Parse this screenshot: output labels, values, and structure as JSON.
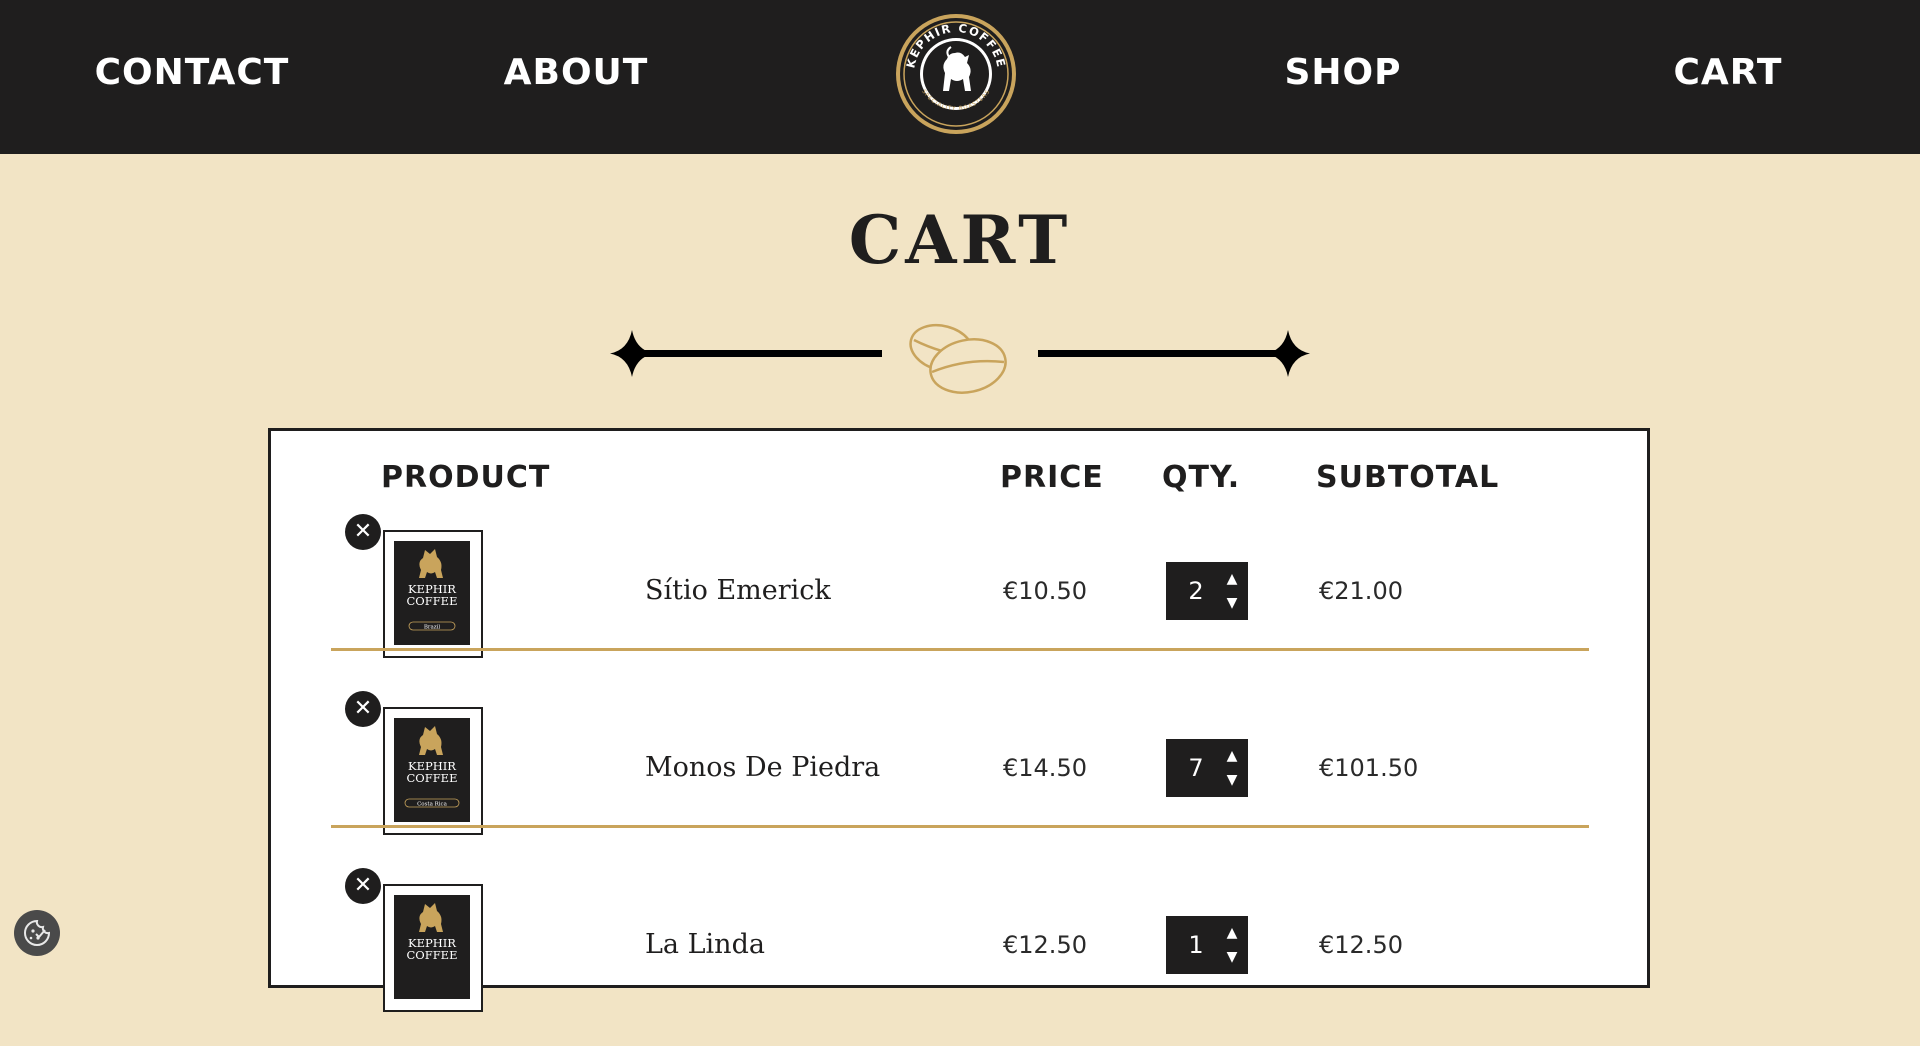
{
  "nav": {
    "contact": "CONTACT",
    "about": "ABOUT",
    "shop": "SHOP",
    "cart": "CART",
    "logo_text_top": "KEPHIR COFFEE",
    "logo_text_bottom": "SPECIALITY ROASTERS"
  },
  "page": {
    "title": "CART"
  },
  "table": {
    "headers": {
      "product": "PRODUCT",
      "price": "PRICE",
      "qty": "QTY.",
      "subtotal": "SUBTOTAL"
    }
  },
  "items": [
    {
      "name": "Sítio Emerick",
      "price": "€10.50",
      "qty": "2",
      "subtotal": "€21.00",
      "label_origin": "Brazil"
    },
    {
      "name": "Monos De Piedra",
      "price": "€14.50",
      "qty": "7",
      "subtotal": "€101.50",
      "label_origin": "Costa Rica"
    },
    {
      "name": "La Linda",
      "price": "€12.50",
      "qty": "1",
      "subtotal": "€12.50",
      "label_origin": ""
    }
  ],
  "bag_label": {
    "brand_line1": "KEPHIR",
    "brand_line2": "COFFEE"
  },
  "icons": {
    "remove": "close-icon",
    "qty_up": "arrow-up-icon",
    "qty_down": "arrow-down-icon",
    "cookie": "cookie-settings-icon",
    "divider": "coffee-beans-icon"
  },
  "colors": {
    "nav_bg": "#1f1e1e",
    "page_bg": "#f2e4c5",
    "gold": "#c9a45c",
    "text_dark": "#1f1e1e"
  }
}
